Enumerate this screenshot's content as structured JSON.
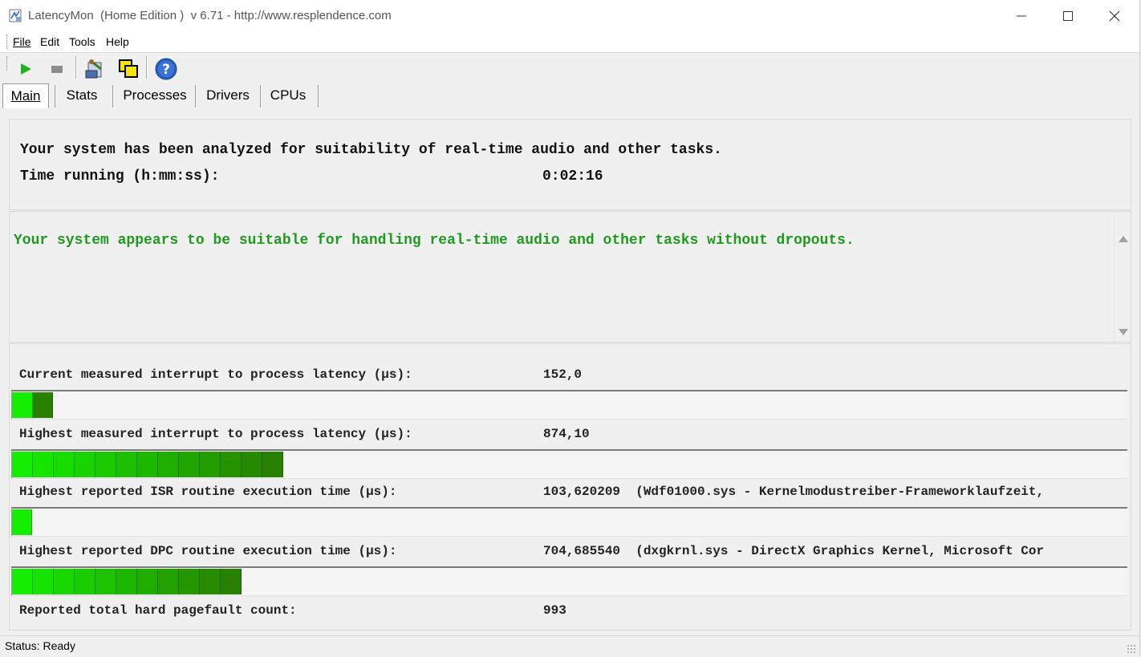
{
  "window": {
    "title": "LatencyMon  (Home Edition )  v 6.71 - http://www.resplendence.com"
  },
  "menu": [
    "File",
    "Edit",
    "Tools",
    "Help"
  ],
  "toolbar": {
    "icons": [
      "play-icon",
      "stop-icon",
      "report-icon",
      "copy-windows-icon",
      "help-icon"
    ],
    "colors": {
      "play": "#22b022",
      "stop": "#8c8c8c",
      "help": "#2a5fc4"
    }
  },
  "tabs": [
    "Main",
    "Stats",
    "Processes",
    "Drivers",
    "CPUs"
  ],
  "summary": {
    "analyzed_text": "Your system has been analyzed for suitability of real-time audio and other tasks.",
    "time_label": "Time running (h:mm:ss):",
    "time_value": "0:02:16"
  },
  "verdict": {
    "text": "Your system appears to be suitable for handling real-time audio and other tasks without dropouts.",
    "color": "#1f9a1f"
  },
  "metrics": [
    {
      "label": "Current measured interrupt to process latency (µs):",
      "value": "152,0",
      "detail": "",
      "fill_segments": 2
    },
    {
      "label": "Highest measured interrupt to process latency (µs):",
      "value": "874,10",
      "detail": "",
      "fill_segments": 13
    },
    {
      "label": "Highest reported ISR routine execution time (µs):",
      "value": "103,620209",
      "detail": "(Wdf01000.sys - Kernelmodustreiber-Frameworklaufzeit,",
      "fill_segments": 1
    },
    {
      "label": "Highest reported DPC routine execution time (µs):",
      "value": "704,685540",
      "detail": "(dxgkrnl.sys - DirectX Graphics Kernel, Microsoft Cor",
      "fill_segments": 11
    },
    {
      "label": "Reported total hard pagefault count:",
      "value": "993",
      "detail": ""
    }
  ],
  "status": {
    "text": "Status: Ready"
  }
}
